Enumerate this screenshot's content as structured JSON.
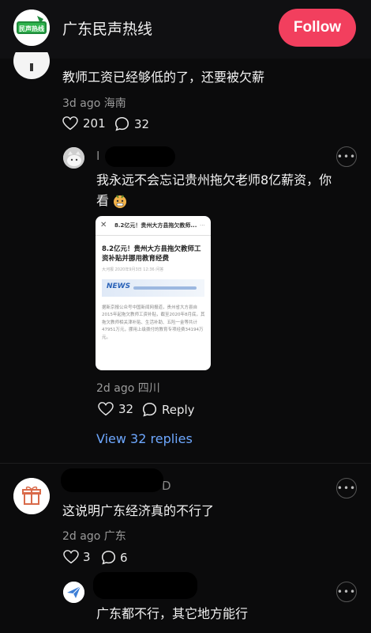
{
  "header": {
    "title": "广东民声热线",
    "follow_label": "Follow",
    "avatar_text": "民声热线"
  },
  "comments": [
    {
      "text": "教师工资已经够低的了，还要被欠薪",
      "time": "3d ago",
      "location": "海南",
      "likes": "201",
      "replies": "32"
    },
    {
      "username_visible": "I",
      "text_line1": "我永远不会忘记贵州拖欠老师8亿薪资，你",
      "text_line2": "看",
      "image": {
        "topbar": "8.2亿元！贵州大方县拖欠教师...",
        "title": "8.2亿元！贵州大方县拖欠教师工资补贴并挪用教育经费",
        "meta": "大河报  2020年9月3日 12:36  问答",
        "body": "据新京报公众号中国新闻网报道，贵州省大方县自2015年起拖欠教师工资补贴，截至2020年8月底，其拖欠教师相关津补贴、生活补助、五险一金等共计47951万元，挪用上级拨付的教育专项经费34194万元。"
      },
      "time": "2d ago",
      "location": "四川",
      "likes": "32",
      "reply_label": "Reply",
      "view_replies": "View 32 replies"
    },
    {
      "username_visible": "D",
      "text": "这说明广东经济真的不行了",
      "time": "2d ago",
      "location": "广东",
      "likes": "3",
      "replies": "6"
    },
    {
      "text": "广东都不行，其它地方能行"
    }
  ],
  "colors": {
    "accent": "#f23f5e",
    "link": "#6ea8ff",
    "background": "#0b0b0c"
  }
}
